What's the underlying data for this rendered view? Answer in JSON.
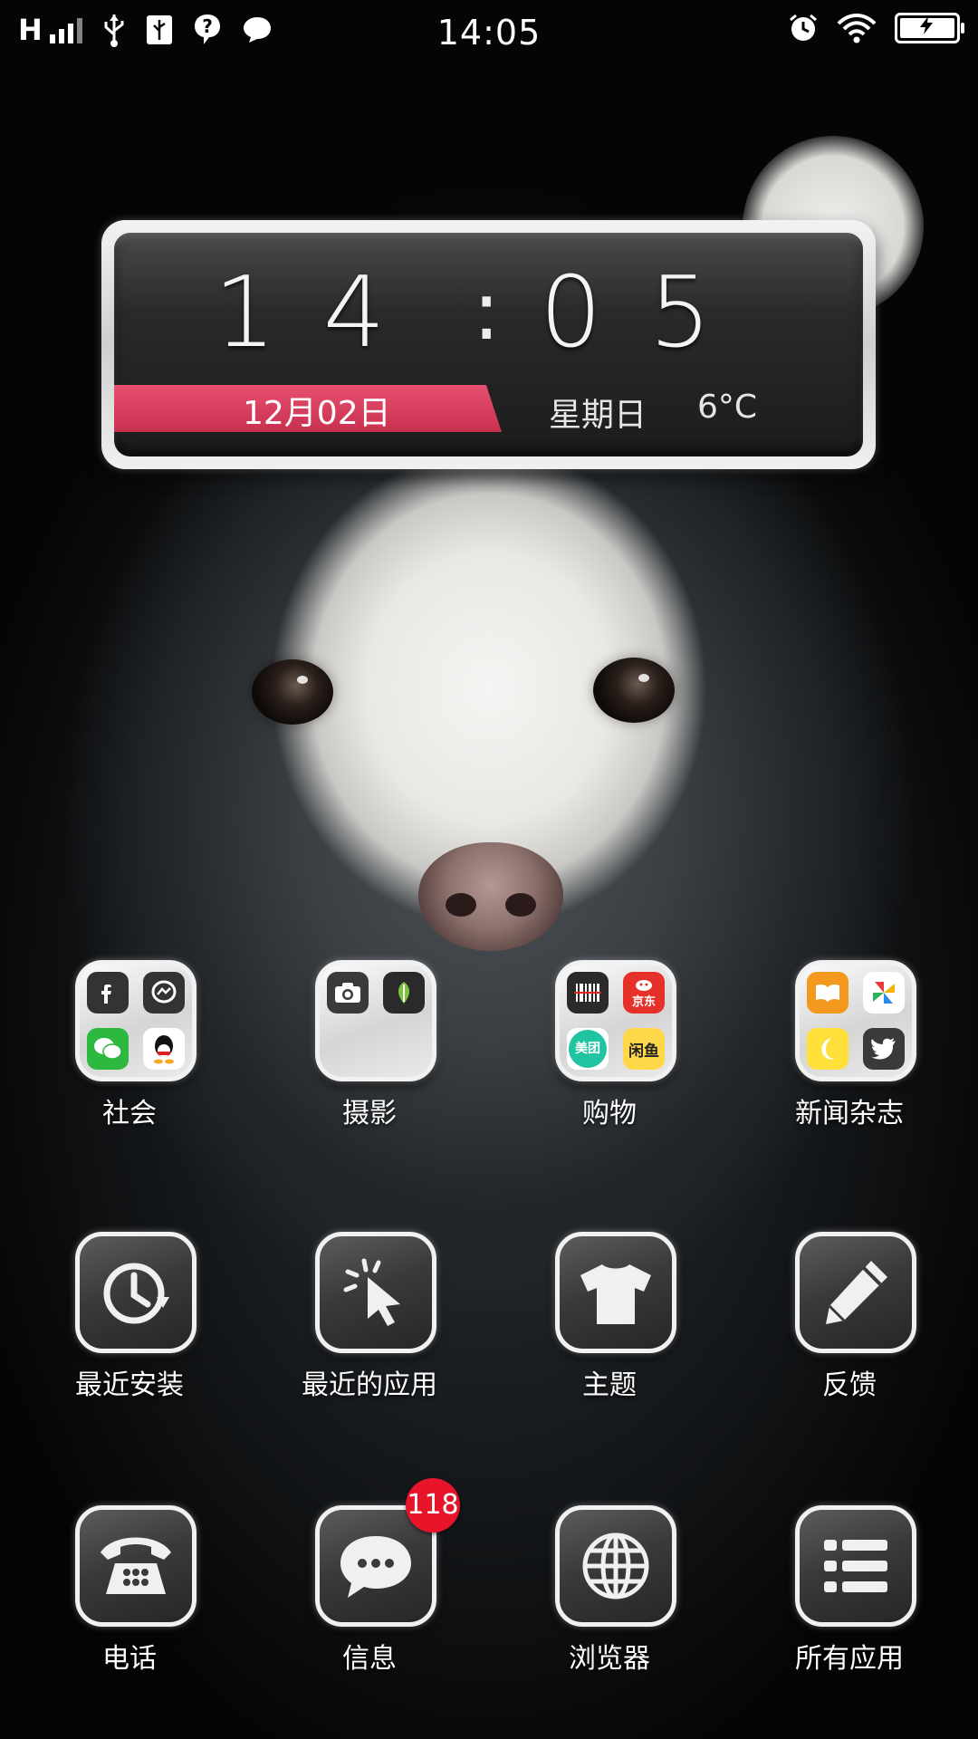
{
  "status_bar": {
    "network_type": "H",
    "time": "14:05",
    "left_icons": [
      "signal-icon",
      "usb-icon",
      "usb-debug-icon",
      "help-icon",
      "message-icon"
    ],
    "right_icons": [
      "alarm-icon",
      "wifi-icon",
      "battery-charging-icon"
    ]
  },
  "clock_widget": {
    "hours": "14",
    "minutes": "05",
    "date": "12月02日",
    "weekday": "星期日",
    "temperature": "6°C",
    "accent_color": "#d63a5a"
  },
  "folders": [
    {
      "label": "社会",
      "apps": [
        "facebook-icon",
        "messenger-icon",
        "wechat-icon",
        "qq-icon"
      ]
    },
    {
      "label": "摄影",
      "apps": [
        "camera-icon",
        "snapseed-icon"
      ]
    },
    {
      "label": "购物",
      "apps": [
        "barcode-icon",
        "jd-icon",
        "meituan-icon",
        "xianyu-icon"
      ],
      "mini_labels": {
        "jd": "京东",
        "meituan": "美团",
        "xianyu": "闲鱼"
      }
    },
    {
      "label": "新闻杂志",
      "apps": [
        "books-icon",
        "pinwheel-icon",
        "moon-icon",
        "twitter-icon"
      ]
    }
  ],
  "apps_row1": [
    {
      "label": "最近安装",
      "icon": "recent-install-icon"
    },
    {
      "label": "最近的应用",
      "icon": "recent-apps-icon"
    },
    {
      "label": "主题",
      "icon": "theme-icon"
    },
    {
      "label": "反馈",
      "icon": "feedback-icon"
    }
  ],
  "dock": [
    {
      "label": "电话",
      "icon": "phone-icon"
    },
    {
      "label": "信息",
      "icon": "messages-icon",
      "badge": "118"
    },
    {
      "label": "浏览器",
      "icon": "browser-icon"
    },
    {
      "label": "所有应用",
      "icon": "all-apps-icon"
    }
  ]
}
